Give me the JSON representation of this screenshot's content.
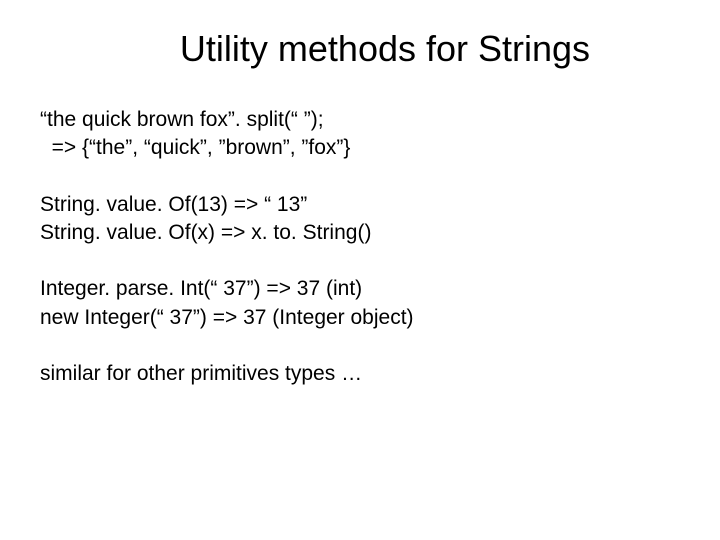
{
  "title": "Utility methods for Strings",
  "g1": {
    "l1": "“the quick brown fox”. split(“ ”);",
    "l2": "  => {“the”, “quick”, ”brown”, ”fox”}"
  },
  "g2": {
    "l1": "String. value. Of(13) => “ 13”",
    "l2": "String. value. Of(x) => x. to. String()"
  },
  "g3": {
    "l1": "Integer. parse. Int(“ 37”) => 37 (int)",
    "l2": "new Integer(“ 37”) => 37 (Integer object)"
  },
  "g4": {
    "l1": "similar for other primitives types …"
  }
}
